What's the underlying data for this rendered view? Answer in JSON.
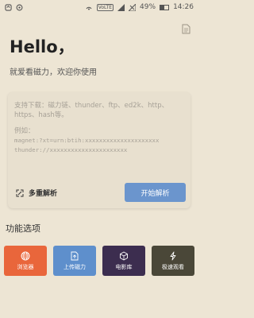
{
  "status_bar": {
    "signal_label": "VoLTE",
    "battery": "49%",
    "time": "14:26"
  },
  "main": {
    "greeting": "Hello，",
    "subtitle": "就爱看磁力，欢迎你使用",
    "input": {
      "hint_line1": "支持下载：磁力链、thunder、ftp、ed2k、http、",
      "hint_line2": "https、hash等。",
      "example_label": "例如：",
      "example_magnet": "magnet:?xt=urn:btih:xxxxxxxxxxxxxxxxxxxxx",
      "example_thunder": "thunder://xxxxxxxxxxxxxxxxxxxxxx"
    },
    "multi_parse_label": "多重解析",
    "start_button": "开始解析"
  },
  "functions": {
    "title": "功能选项",
    "items": [
      {
        "label": "浏览器",
        "icon": "globe-icon",
        "color": "#e9663b"
      },
      {
        "label": "上传磁力",
        "icon": "upload-doc-icon",
        "color": "#5e8fcc"
      },
      {
        "label": "电影库",
        "icon": "cube-icon",
        "color": "#3c2d4f"
      },
      {
        "label": "极速观看",
        "icon": "lightning-icon",
        "color": "#4a4738"
      }
    ]
  }
}
